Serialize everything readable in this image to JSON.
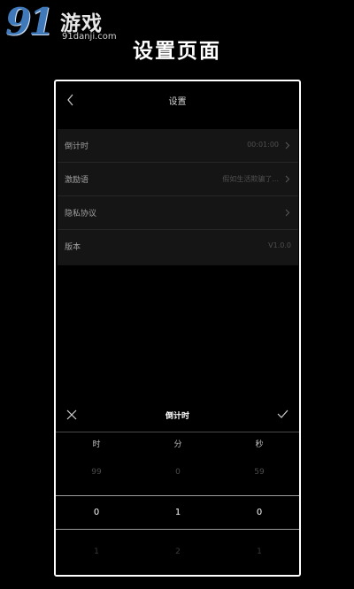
{
  "watermark": {
    "number": "91",
    "name": "游戏",
    "url": "91danji.com"
  },
  "caption": "设置页面",
  "nav": {
    "title": "设置"
  },
  "settings": [
    {
      "label": "倒计时",
      "value": "00:01:00",
      "arrow": true
    },
    {
      "label": "激励语",
      "value": "假如生活欺骗了...",
      "arrow": true
    },
    {
      "label": "隐私协议",
      "value": "",
      "arrow": true
    },
    {
      "label": "版本",
      "value": "V1.0.0",
      "arrow": false
    }
  ],
  "picker": {
    "title": "倒计时",
    "columns": [
      "时",
      "分",
      "秒"
    ],
    "prev_row": [
      "99",
      "0",
      "59"
    ],
    "selected_row": [
      "0",
      "1",
      "0"
    ],
    "next_row": [
      "1",
      "2",
      "1"
    ]
  },
  "colors": {
    "background": "#000000",
    "watermark_blue": "#3f79b9",
    "row_bg": "#151515"
  },
  "icons": [
    "back-icon",
    "chevron-right-icon",
    "close-icon",
    "check-icon"
  ]
}
